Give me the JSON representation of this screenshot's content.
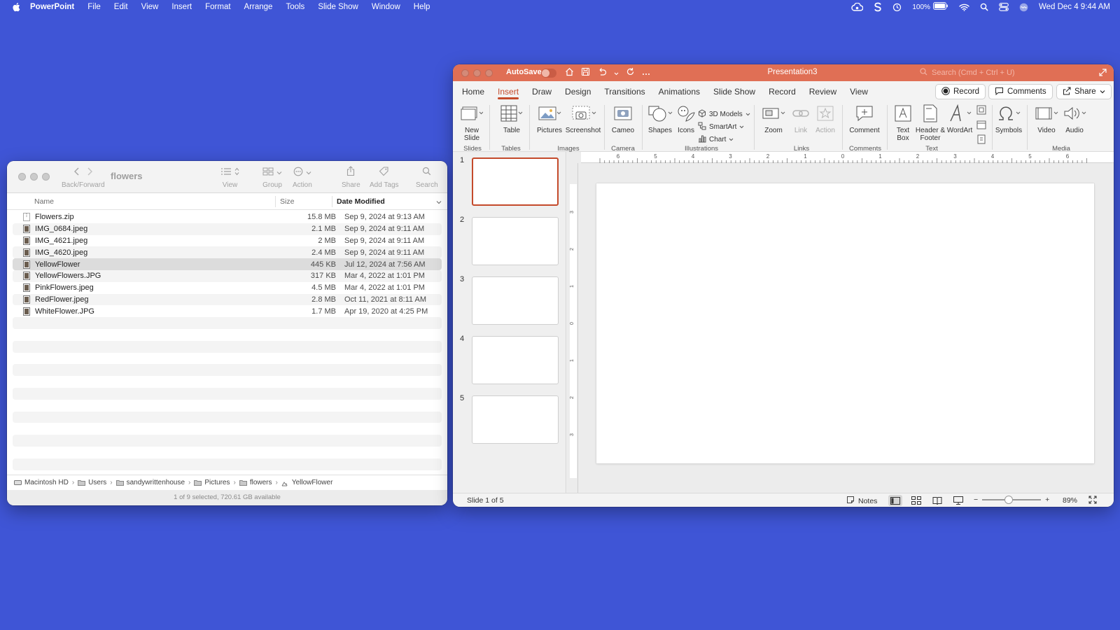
{
  "menubar": {
    "app_name": "PowerPoint",
    "items": [
      "File",
      "Edit",
      "View",
      "Insert",
      "Format",
      "Arrange",
      "Tools",
      "Slide Show",
      "Window",
      "Help"
    ],
    "battery": "100%",
    "datetime": "Wed Dec 4  9:44 AM",
    "icons": [
      "creative-cloud-icon",
      "s-icon",
      "time-machine-icon",
      "battery-icon",
      "wifi-icon",
      "spotlight-icon",
      "control-center-icon",
      "siri-icon"
    ]
  },
  "finder": {
    "title": "flowers",
    "toolbar": {
      "back_forward": "Back/Forward",
      "view": "View",
      "group": "Group",
      "action": "Action",
      "share": "Share",
      "add_tags": "Add Tags",
      "search": "Search"
    },
    "columns": {
      "name": "Name",
      "size": "Size",
      "date": "Date Modified"
    },
    "files": [
      {
        "name": "Flowers.zip",
        "size": "15.8 MB",
        "date": "Sep 9, 2024 at 9:13 AM",
        "kind": "zip"
      },
      {
        "name": "IMG_0684.jpeg",
        "size": "2.1 MB",
        "date": "Sep 9, 2024 at 9:11 AM",
        "kind": "image"
      },
      {
        "name": "IMG_4621.jpeg",
        "size": "2 MB",
        "date": "Sep 9, 2024 at 9:11 AM",
        "kind": "image"
      },
      {
        "name": "IMG_4620.jpeg",
        "size": "2.4 MB",
        "date": "Sep 9, 2024 at 9:11 AM",
        "kind": "image"
      },
      {
        "name": "YellowFlower",
        "size": "445 KB",
        "date": "Jul 12, 2024 at 7:56 AM",
        "kind": "image",
        "selected": true
      },
      {
        "name": "YellowFlowers.JPG",
        "size": "317 KB",
        "date": "Mar 4, 2022 at 1:01 PM",
        "kind": "image"
      },
      {
        "name": "PinkFlowers.jpeg",
        "size": "4.5 MB",
        "date": "Mar 4, 2022 at 1:01 PM",
        "kind": "image"
      },
      {
        "name": "RedFlower.jpeg",
        "size": "2.8 MB",
        "date": "Oct 11, 2021 at 8:11 AM",
        "kind": "image"
      },
      {
        "name": "WhiteFlower.JPG",
        "size": "1.7 MB",
        "date": "Apr 19, 2020 at 4:25 PM",
        "kind": "image"
      }
    ],
    "path": [
      "Macintosh HD",
      "Users",
      "sandywrittenhouse",
      "Pictures",
      "flowers",
      "YellowFlower"
    ],
    "status": "1 of 9 selected, 720.61 GB available"
  },
  "ppt": {
    "autosave": "AutoSave",
    "doc_title": "Presentation3",
    "search_placeholder": "Search (Cmd + Ctrl + U)",
    "tabs": [
      "Home",
      "Insert",
      "Draw",
      "Design",
      "Transitions",
      "Animations",
      "Slide Show",
      "Record",
      "Review",
      "View"
    ],
    "active_tab": "Insert",
    "buttons": {
      "record": "Record",
      "comments": "Comments",
      "share": "Share"
    },
    "ribbon": {
      "new_slide": "New Slide",
      "table": "Table",
      "pictures": "Pictures",
      "screenshot": "Screenshot",
      "cameo": "Cameo",
      "shapes": "Shapes",
      "icons": "Icons",
      "models3d": "3D Models",
      "smartart": "SmartArt",
      "chart": "Chart",
      "zoom": "Zoom",
      "link": "Link",
      "action": "Action",
      "comment": "Comment",
      "text_box": "Text Box",
      "header_footer": "Header & Footer",
      "wordart": "WordArt",
      "symbols": "Symbols",
      "video": "Video",
      "audio": "Audio",
      "groups": [
        "Slides",
        "Tables",
        "Images",
        "Camera",
        "Illustrations",
        "Links",
        "Comments",
        "Text",
        "Media"
      ]
    },
    "slides": [
      "1",
      "2",
      "3",
      "4",
      "5"
    ],
    "selected_slide": 1,
    "ruler_h": [
      "6",
      "5",
      "4",
      "3",
      "2",
      "1",
      "0",
      "1",
      "2",
      "3",
      "4",
      "5",
      "6"
    ],
    "ruler_v": [
      "3",
      "2",
      "1",
      "0",
      "1",
      "2",
      "3"
    ],
    "status": {
      "slide_count": "Slide 1 of 5",
      "notes": "Notes",
      "zoom": "89%",
      "zoom_fraction": 0.45
    }
  }
}
